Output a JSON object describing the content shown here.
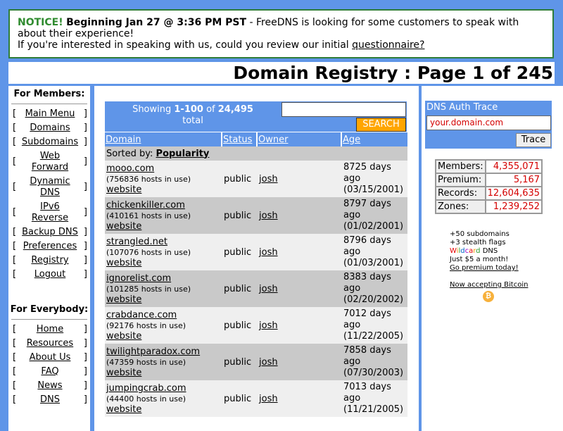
{
  "notice": {
    "label": "NOTICE!",
    "headline": "Beginning Jan 27 @ 3:36 PM PST",
    "text1": " - FreeDNS is looking for some customers to speak with about their experience!",
    "text2": "If you're interested in speaking with us, could you review our initial ",
    "link": "questionnaire?"
  },
  "page_title": "Domain Registry : Page 1 of 245",
  "members": {
    "heading": "For Members:",
    "items": [
      "Main Menu",
      "Domains",
      "Subdomains",
      "Web Forward",
      "Dynamic DNS",
      "IPv6 Reverse",
      "Backup DNS",
      "Preferences",
      "Registry",
      "Logout"
    ]
  },
  "everybody": {
    "heading": "For Everybody:",
    "items": [
      "Home",
      "Resources",
      "About Us",
      "FAQ",
      "News",
      "DNS"
    ]
  },
  "showing": {
    "prefix": "Showing ",
    "range": "1-100",
    "of": " of ",
    "count": "24,495",
    "suffix": "total"
  },
  "search_button": "SEARCH",
  "table": {
    "headers": [
      "Domain",
      "Status",
      "Owner",
      "Age"
    ],
    "sorted_label": "Sorted by: ",
    "sorted_value": "Popularity",
    "rows": [
      {
        "domain": "mooo.com",
        "hosts": "(756836 hosts in use)",
        "website": "website",
        "status": "public",
        "owner": "josh",
        "age1": "8725 days ago",
        "age2": "(03/15/2001)"
      },
      {
        "domain": "chickenkiller.com",
        "hosts": "(410161 hosts in use)",
        "website": "website",
        "status": "public",
        "owner": "josh",
        "age1": "8797 days ago",
        "age2": "(01/02/2001)"
      },
      {
        "domain": "strangled.net",
        "hosts": "(107076 hosts in use)",
        "website": "website",
        "status": "public",
        "owner": "josh",
        "age1": "8796 days ago",
        "age2": "(01/03/2001)"
      },
      {
        "domain": "ignorelist.com",
        "hosts": "(101285 hosts in use)",
        "website": "website",
        "status": "public",
        "owner": "josh",
        "age1": "8383 days ago",
        "age2": "(02/20/2002)"
      },
      {
        "domain": "crabdance.com",
        "hosts": "(92176 hosts in use)",
        "website": "website",
        "status": "public",
        "owner": "josh",
        "age1": "7012 days ago",
        "age2": "(11/22/2005)"
      },
      {
        "domain": "twilightparadox.com",
        "hosts": "(47359 hosts in use)",
        "website": "website",
        "status": "public",
        "owner": "josh",
        "age1": "7858 days ago",
        "age2": "(07/30/2003)"
      },
      {
        "domain": "jumpingcrab.com",
        "hosts": "(44400 hosts in use)",
        "website": "website",
        "status": "public",
        "owner": "josh",
        "age1": "7013 days ago",
        "age2": "(11/21/2005)"
      }
    ]
  },
  "dns_trace": {
    "heading": "DNS Auth Trace",
    "placeholder": "your.domain.com",
    "button": "Trace"
  },
  "stats": [
    {
      "label": "Members:",
      "value": "4,355,071"
    },
    {
      "label": "Premium:",
      "value": "5,167"
    },
    {
      "label": "Records:",
      "value": "12,604,635"
    },
    {
      "label": "Zones:",
      "value": "1,239,252"
    }
  ],
  "promo": {
    "line1": "+50 subdomains",
    "line2": "+3 stealth flags",
    "wildcard_letters": [
      "W",
      "i",
      "l",
      "d",
      "c",
      "a",
      "r",
      "d"
    ],
    "line3_suffix": " DNS",
    "line4": "Just $5 a month!",
    "link": "Go premium today!",
    "bitcoin": "Now accepting Bitcoin",
    "bitcoin_icon": "₿"
  }
}
